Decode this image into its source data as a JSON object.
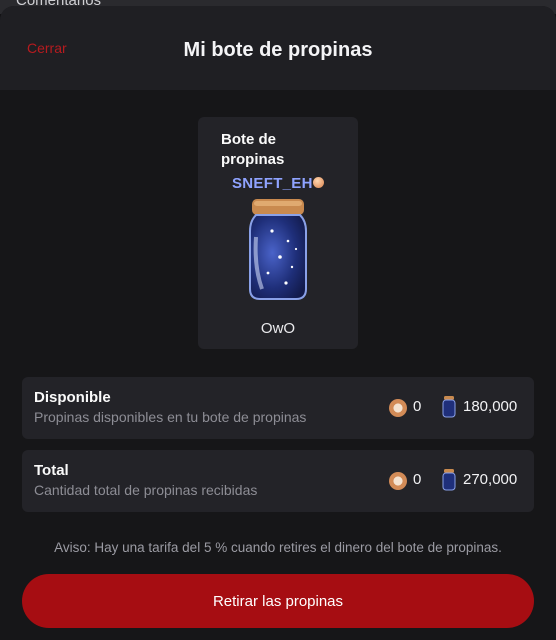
{
  "background_section": {
    "label": "Comentarios"
  },
  "header": {
    "close_label": "Cerrar",
    "title": "Mi bote de propinas"
  },
  "card": {
    "title": "Bote de propinas",
    "username": "SNEFT_EH",
    "name": "OwO",
    "icon": "tip-jar-icon"
  },
  "available": {
    "title": "Disponible",
    "subtitle": "Propinas disponibles en tu bote de propinas",
    "coins": "0",
    "jar_amount": "180,000"
  },
  "total": {
    "title": "Total",
    "subtitle": "Cantidad total de propinas recibidas",
    "coins": "0",
    "jar_amount": "270,000"
  },
  "notice": "Aviso: Hay una tarifa del 5 % cuando retires el dinero del bote de propinas.",
  "withdraw_label": "Retirar las propinas",
  "colors": {
    "accent": "#a60d12",
    "username": "#8fa3ff",
    "background": "#121214"
  }
}
